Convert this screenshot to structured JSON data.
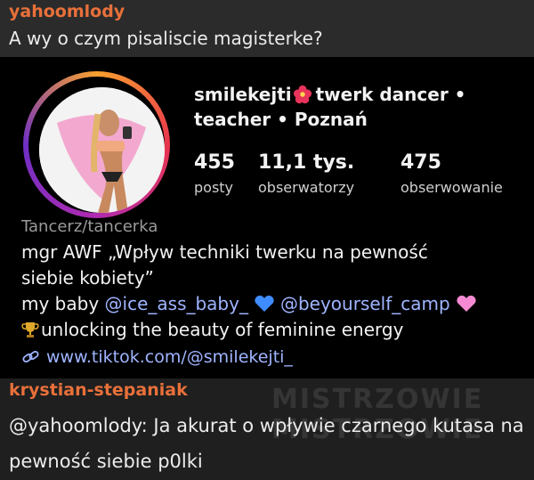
{
  "post1": {
    "author": "yahoomlody",
    "message": "A wy o czym pisaliscie magisterke?"
  },
  "profile": {
    "username": "smilekejti",
    "headline_rest": "twerk dancer •",
    "headline_line2": "teacher • Poznań",
    "stats": [
      {
        "value": "455",
        "label": "posty"
      },
      {
        "value": "11,1 tys.",
        "label": "obserwatorzy"
      },
      {
        "value": "475",
        "label": "obserwowanie"
      }
    ],
    "category": "Tancerz/tancerka",
    "bio_line1": "mgr AWF „Wpływ techniki twerku na pewność",
    "bio_line2": "siebie kobiety”",
    "bio_line3_prefix": "my baby",
    "mention1": "@ice_ass_baby_",
    "mention2": "@beyourself_camp",
    "bio_line4": "unlocking the beauty of feminine energy",
    "link": "www.tiktok.com/@smilekejti_",
    "icons": [
      "flower-icon",
      "blue-heart-icon",
      "pink-heart-icon",
      "trophy-icon",
      "link-icon"
    ],
    "colors": {
      "mention": "#9fb4ff",
      "blue_heart": "#3f8cff",
      "pink_heart": "#f58ad3"
    }
  },
  "post2": {
    "author": "krystian-stepaniak",
    "message": "@yahoomlody: Ja akurat o wpływie czarnego kutasa na pewność siebie p0lki"
  },
  "colors": {
    "author": "#e8703a",
    "card_bg": "#000000",
    "post_bg": "#2b2b2b"
  }
}
